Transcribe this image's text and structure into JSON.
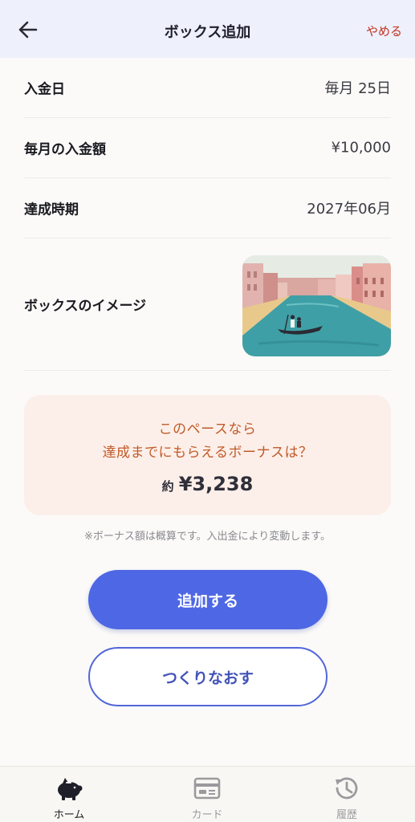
{
  "header": {
    "title": "ボックス追加",
    "cancel_label": "やめる"
  },
  "form": {
    "deposit_day": {
      "label": "入金日",
      "value": "毎月 25日"
    },
    "monthly_amount": {
      "label": "毎月の入金額",
      "value": "¥10,000"
    },
    "target_date": {
      "label": "達成時期",
      "value": "2027年06月"
    },
    "box_image": {
      "label": "ボックスのイメージ"
    }
  },
  "bonus": {
    "line1": "このペースなら",
    "line2": "達成までにもらえるボーナスは？",
    "prefix": "約",
    "amount": "¥3,238"
  },
  "note": "※ボーナス額は概算です。入出金により変動します。",
  "actions": {
    "primary_label": "追加する",
    "secondary_label": "つくりなおす"
  },
  "nav": {
    "items": [
      {
        "label": "ホーム",
        "icon": "piggy-bank-icon",
        "active": true
      },
      {
        "label": "カード",
        "icon": "card-icon",
        "active": false
      },
      {
        "label": "履歴",
        "icon": "history-icon",
        "active": false
      }
    ]
  },
  "colors": {
    "accent": "#4e67e4",
    "header_bg": "#eef0fb",
    "cancel": "#c2321f",
    "bonus_bg": "#fcefe9",
    "bonus_text": "#c25a2a"
  }
}
